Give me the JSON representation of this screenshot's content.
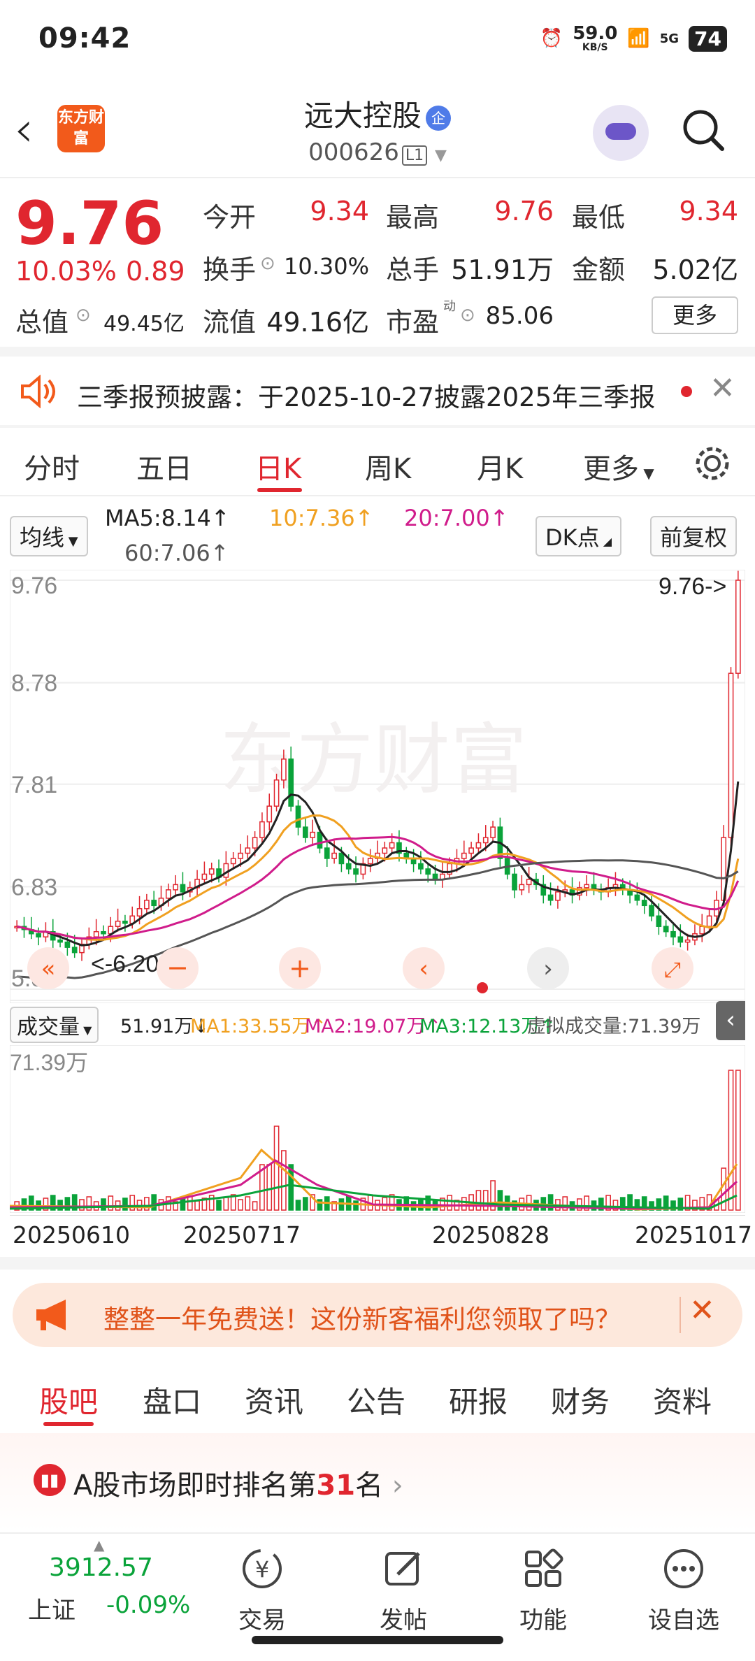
{
  "status_bar": {
    "time": "09:42",
    "net_speed": "59.0",
    "net_unit": "KB/S",
    "signal": "5G",
    "battery": "74"
  },
  "header": {
    "name": "远大控股",
    "ent_badge": "企",
    "code": "000626",
    "level": "L1",
    "logo_text": "东方财富"
  },
  "quote": {
    "price": "9.76",
    "change_pct": "10.03%",
    "change_abs": "0.89",
    "open_label": "今开",
    "open": "9.34",
    "high_label": "最高",
    "high": "9.76",
    "low_label": "最低",
    "low": "9.34",
    "turnover_label": "换手",
    "turnover": "10.30%",
    "vol_label": "总手",
    "vol": "51.91万",
    "amount_label": "金额",
    "amount": "5.02亿",
    "mcap_label": "总值",
    "mcap": "49.45亿",
    "float_label": "流值",
    "float": "49.16亿",
    "pe_label": "市盈",
    "pe_sup": "动",
    "pe": "85.06",
    "more": "更多"
  },
  "notice": {
    "text": "三季报预披露：于2025-10-27披露2025年三季报"
  },
  "ktabs": [
    "分时",
    "五日",
    "日K",
    "周K",
    "月K",
    "更多"
  ],
  "ktab_active": "日K",
  "chart_controls": {
    "ma_select": "均线",
    "ma5": "MA5:8.14↑",
    "ma10": "10:7.36↑",
    "ma20": "20:7.00↑",
    "ma60": "60:7.06↑",
    "dk": "DK点",
    "adjust": "前复权"
  },
  "colors": {
    "up": "#e0262f",
    "down": "#0aa33a",
    "ma5": "#222222",
    "ma10": "#f0a020",
    "ma20": "#d01c8b",
    "ma60": "#555555"
  },
  "chart_data": {
    "type": "candlestick",
    "y_labels": [
      "9.76",
      "8.78",
      "7.81",
      "6.83",
      "5.85"
    ],
    "ylim": [
      5.85,
      9.76
    ],
    "max_label": "9.76->",
    "min_label": "<-6.20",
    "x_labels": [
      "20250610",
      "20250717",
      "20250828",
      "20251017"
    ],
    "watermark": "东方财富",
    "close": [
      6.45,
      6.42,
      6.38,
      6.35,
      6.4,
      6.32,
      6.3,
      6.25,
      6.2,
      6.28,
      6.35,
      6.4,
      6.38,
      6.45,
      6.5,
      6.48,
      6.55,
      6.62,
      6.7,
      6.65,
      6.72,
      6.8,
      6.85,
      6.78,
      6.82,
      6.9,
      6.95,
      7.0,
      6.92,
      7.05,
      7.1,
      7.15,
      7.2,
      7.3,
      7.45,
      7.6,
      7.85,
      8.05,
      7.6,
      7.4,
      7.3,
      7.35,
      7.2,
      7.1,
      7.15,
      7.05,
      7.0,
      6.95,
      7.05,
      7.1,
      7.15,
      7.2,
      7.25,
      7.15,
      7.1,
      7.05,
      7.0,
      6.95,
      6.9,
      6.95,
      7.05,
      7.1,
      7.15,
      7.2,
      7.25,
      7.3,
      7.4,
      7.1,
      6.95,
      6.8,
      6.85,
      6.9,
      6.85,
      6.75,
      6.7,
      6.78,
      6.8,
      6.75,
      6.82,
      6.85,
      6.8,
      6.78,
      6.82,
      6.85,
      6.8,
      6.75,
      6.7,
      6.65,
      6.55,
      6.45,
      6.4,
      6.35,
      6.3,
      6.32,
      6.38,
      6.45,
      6.55,
      6.7,
      7.3,
      8.87,
      9.76
    ],
    "ma5_series": [
      6.5,
      6.5,
      6.45,
      6.4,
      6.38,
      6.35,
      6.3,
      6.28,
      6.25,
      6.3,
      6.4,
      6.5,
      6.6,
      6.7,
      6.8,
      6.9,
      7.05,
      7.3,
      7.6,
      7.55,
      7.4,
      7.3,
      7.2,
      7.1,
      7.05,
      7.1,
      7.2,
      7.2,
      7.15,
      7.05,
      7.0,
      7.1,
      7.2,
      7.0,
      6.9,
      6.85,
      6.82,
      6.8,
      6.8,
      6.78,
      6.7,
      6.55,
      6.4,
      6.35,
      6.4,
      6.6,
      7.2,
      8.14
    ],
    "volume_label": "成交量",
    "vol_value": "51.91万↓",
    "vol_ma1": "MA1:33.55万↑",
    "vol_ma2": "MA2:19.07万↑",
    "vol_ma3": "MA3:12.13万↑",
    "vol_virtual": "虚拟成交量:71.39万",
    "vol_max": "71.39万"
  },
  "promo": {
    "text": "整整一年免费送！这份新客福利您领取了吗？"
  },
  "bottom_tabs": [
    "股吧",
    "盘口",
    "资讯",
    "公告",
    "研报",
    "财务",
    "资料"
  ],
  "bottom_tab_active": "股吧",
  "rank": {
    "prefix": "A股市场即时排名第",
    "num": "31",
    "suffix": "名"
  },
  "index": {
    "name": "上证",
    "value": "3912.57",
    "change": "-0.09%"
  },
  "nav": {
    "trade": "交易",
    "post": "发帖",
    "func": "功能",
    "watch": "设自选"
  }
}
